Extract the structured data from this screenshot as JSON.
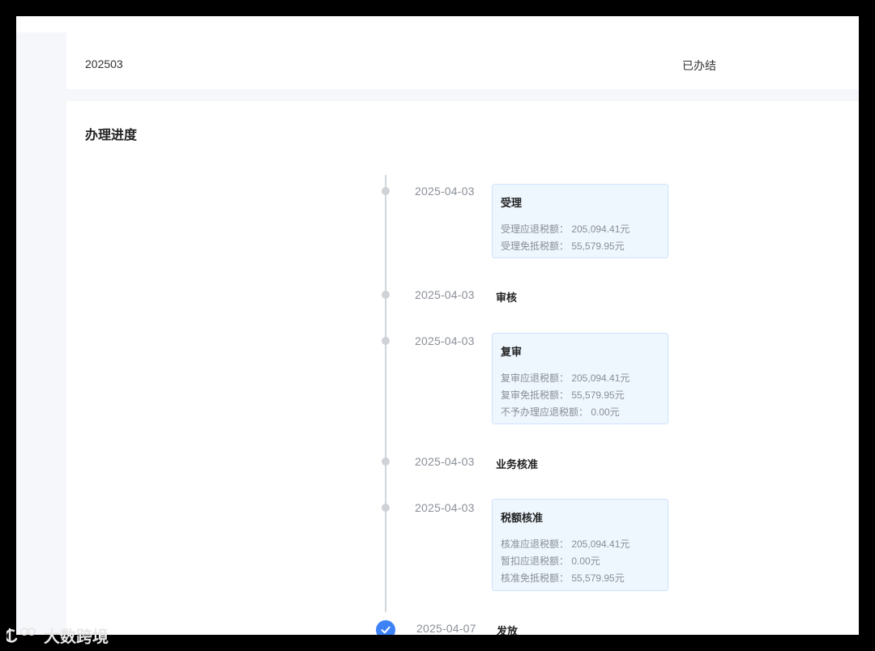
{
  "summary": {
    "period": "202503",
    "status": "已办结"
  },
  "progress": {
    "title": "办理进度",
    "steps": [
      {
        "date": "2025-04-03",
        "title": "受理",
        "details": [
          "受理应退税额： 205,094.41元",
          "受理免抵税额： 55,579.95元"
        ]
      },
      {
        "date": "2025-04-03",
        "title": "审核",
        "details": []
      },
      {
        "date": "2025-04-03",
        "title": "复审",
        "details": [
          "复审应退税额： 205,094.41元",
          "复审免抵税额： 55,579.95元",
          "不予办理应退税额： 0.00元"
        ]
      },
      {
        "date": "2025-04-03",
        "title": "业务核准",
        "details": []
      },
      {
        "date": "2025-04-03",
        "title": "税额核准",
        "details": [
          "核准应退税额： 205,094.41元",
          "暂扣应退税额： 0.00元",
          "核准免抵税额： 55,579.95元"
        ]
      },
      {
        "date": "2025-04-07",
        "title": "发放",
        "details": [],
        "completed": true
      }
    ]
  },
  "watermark": {
    "text": "大数跨境",
    "icon": "brand-logo-icon"
  },
  "colors": {
    "accent": "#3d83f7",
    "card_bg": "#eef6fe",
    "card_border": "#cfe3fa",
    "dot_gray": "#cfd2d6"
  }
}
